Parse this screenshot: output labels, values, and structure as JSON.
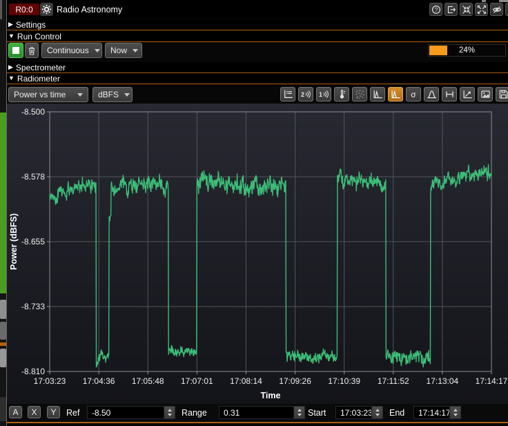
{
  "window": {
    "badge": "R0:0",
    "title": "Radio Astronomy",
    "titlebar_icons": [
      "settings-gear",
      "help",
      "undock",
      "shrink",
      "maximize",
      "hide",
      "close"
    ]
  },
  "sections": {
    "settings": {
      "label": "Settings",
      "collapsed": true
    },
    "run_control": {
      "label": "Run Control",
      "collapsed": false
    },
    "spectrometer": {
      "label": "Spectrometer",
      "collapsed": true
    },
    "radiometer": {
      "label": "Radiometer",
      "collapsed": false
    }
  },
  "run_control": {
    "stop_button": "stop",
    "clear_button": "clear-measurements",
    "run_mode": "Continuous",
    "start_time": "Now",
    "progress": {
      "label": "24%",
      "fraction": 0.24
    }
  },
  "radiometer": {
    "display_mode": "Power vs time",
    "units": "dBFS",
    "toolbar_icons": [
      "chart-legend",
      "calibrate-hot",
      "calibrate-cold",
      "temperature",
      "scatter-points",
      "distribution",
      "distribution-active",
      "sigma",
      "gaussian-fit",
      "peak-width",
      "trend-marker",
      "save-image",
      "save-data"
    ],
    "icon_labels": {
      "two": "2",
      "one": "1",
      "sigma": "σ"
    }
  },
  "chart_data": {
    "type": "line",
    "title": "",
    "xlabel": "Time",
    "ylabel": "Power (dBFS)",
    "x_ticks": [
      "17:03:23",
      "17:04:36",
      "17:05:48",
      "17:07:01",
      "17:08:14",
      "17:09:26",
      "17:10:39",
      "17:11:52",
      "17:13:04",
      "17:14:17"
    ],
    "y_ticks": [
      "-8.500",
      "-8.578",
      "-8.655",
      "-8.733",
      "-8.810"
    ],
    "ylim": [
      -8.81,
      -8.5
    ],
    "x_span_seconds": 654,
    "grid": true,
    "legend": false,
    "series": [
      {
        "name": "power_dbfs",
        "color": "#3dbd78",
        "sample_step_seconds": 0.5,
        "segments": [
          {
            "t0": 0,
            "t1": 12,
            "level": -8.598,
            "level_end": -8.607,
            "noise": 0.006
          },
          {
            "t0": 12,
            "t1": 69,
            "level": -8.596,
            "level_end": -8.585,
            "noise": 0.008
          },
          {
            "t0": 69,
            "t1": 72,
            "level": -8.801,
            "noise": 0.004
          },
          {
            "t0": 72,
            "t1": 88,
            "level": -8.792,
            "noise": 0.005
          },
          {
            "t0": 88,
            "t1": 91,
            "level": -8.627,
            "noise": 0.004
          },
          {
            "t0": 91,
            "t1": 176,
            "level": -8.588,
            "noise": 0.008
          },
          {
            "t0": 176,
            "t1": 218,
            "level": -8.788,
            "noise": 0.005
          },
          {
            "t0": 218,
            "t1": 350,
            "level": -8.584,
            "level_end": -8.589,
            "noise": 0.009
          },
          {
            "t0": 350,
            "t1": 426,
            "level": -8.792,
            "noise": 0.006
          },
          {
            "t0": 426,
            "t1": 498,
            "level": -8.581,
            "level_end": -8.586,
            "noise": 0.008
          },
          {
            "t0": 498,
            "t1": 564,
            "level": -8.794,
            "noise": 0.007
          },
          {
            "t0": 564,
            "t1": 584,
            "level": -8.591,
            "level_end": -8.584,
            "noise": 0.007
          },
          {
            "t0": 584,
            "t1": 654,
            "level": -8.58,
            "level_end": -8.573,
            "noise": 0.007
          }
        ]
      }
    ]
  },
  "bottom_bar": {
    "autoscale_all": "A",
    "autoscale_x": "X",
    "autoscale_y": "Y",
    "ref_label": "Ref",
    "ref_value": "-8.50",
    "range_label": "Range",
    "range_value": "0.31",
    "start_label": "Start",
    "start_value": "17:03:23",
    "end_label": "End",
    "end_value": "17:14:17"
  },
  "colors": {
    "accent_orange": "#b05e10",
    "progress_orange": "#f59a1a",
    "series_green": "#3dbd78",
    "active_button_orange": "#bf7a1f",
    "stop_button_green": "#2f9e2f",
    "badge_red": "#5e0202"
  }
}
